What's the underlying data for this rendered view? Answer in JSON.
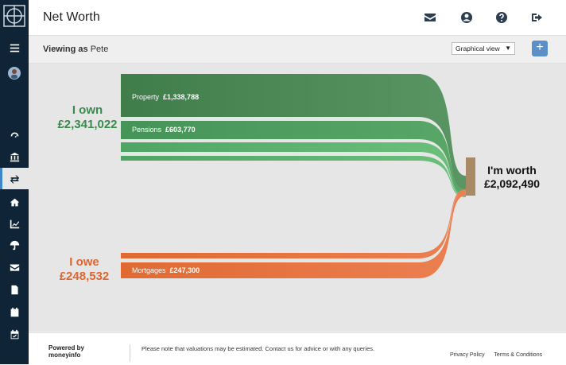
{
  "app": {
    "title": "Net Worth"
  },
  "header_icons": [
    "envelope-icon",
    "user-icon",
    "help-icon",
    "sign-out-icon"
  ],
  "subheader": {
    "viewing_label": "Viewing as",
    "viewing_name": "Pete",
    "view_select": "Graphical view",
    "add_label": "+"
  },
  "sidebar": {
    "items": [
      "menu-icon",
      "avatar",
      "dashboard-icon",
      "bank-icon",
      "transfer-icon",
      "home-icon",
      "chart-icon",
      "umbrella-icon",
      "envelope-icon",
      "document-icon",
      "calendar-icon",
      "calendar-check-icon"
    ]
  },
  "main": {
    "own_label": "I own",
    "own_value": "£2,341,022",
    "owe_label": "I owe",
    "owe_value": "£248,532",
    "worth_label": "I'm worth",
    "worth_value": "£2,092,490",
    "flows": [
      {
        "name": "Property",
        "value": "£1,338,788"
      },
      {
        "name": "Pensions",
        "value": "£603,770"
      },
      {
        "name": "Mortgages",
        "value": "£247,300"
      }
    ]
  },
  "colors": {
    "own_green": "#3a8a4c",
    "owe_orange": "#e0652e",
    "sidebar_bg": "#0f2537",
    "accent_blue": "#5a8fc8"
  },
  "footer": {
    "powered_line1": "Powered by",
    "powered_line2": "moneyinfo",
    "note": "Please note that valuations may be estimated. Contact us for advice or with any queries.",
    "privacy": "Privacy Policy",
    "terms": "Terms & Conditions"
  }
}
